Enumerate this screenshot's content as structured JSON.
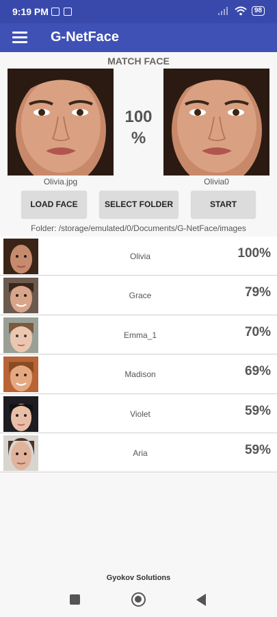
{
  "status_bar": {
    "time": "9:19 PM",
    "battery": "98"
  },
  "app_bar": {
    "title": "G-NetFace"
  },
  "match": {
    "title": "MATCH FACE",
    "percent_value": "100",
    "percent_sign": "%",
    "left_caption": "Olivia.jpg",
    "right_caption": "Olivia0"
  },
  "buttons": {
    "load": "LOAD FACE",
    "select_folder": "SELECT FOLDER",
    "start": "START"
  },
  "folder": "Folder: /storage/emulated/0/Documents/G-NetFace/images",
  "results": [
    {
      "name": "Olivia",
      "score": "100%"
    },
    {
      "name": "Grace",
      "score": "79%"
    },
    {
      "name": "Emma_1",
      "score": "70%"
    },
    {
      "name": "Madison",
      "score": "69%"
    },
    {
      "name": "Violet",
      "score": "59%"
    },
    {
      "name": "Aria",
      "score": "59%"
    }
  ],
  "footer": "Gyokov Solutions",
  "colors": {
    "status_bar": "#3949ab",
    "app_bar": "#3f51b5",
    "button": "#dcdcdc"
  }
}
